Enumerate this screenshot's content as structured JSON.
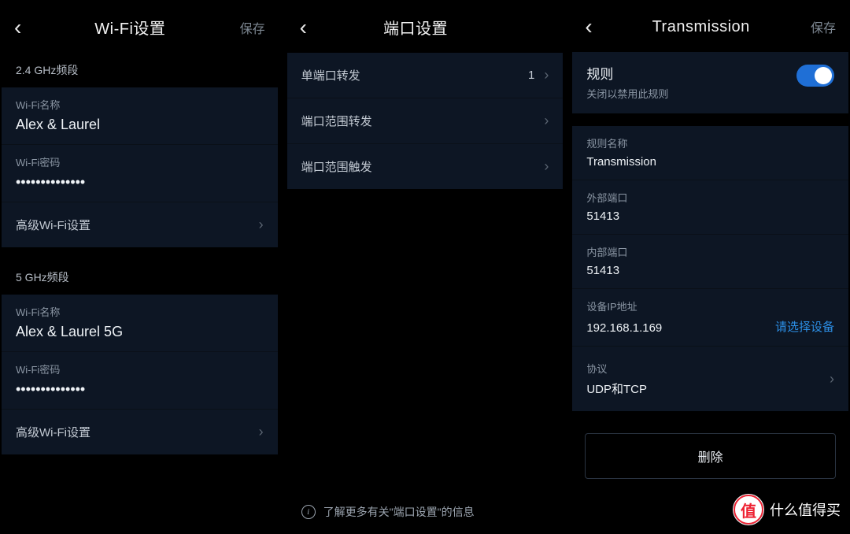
{
  "watermark": {
    "badge": "值",
    "text": "什么值得买"
  },
  "panel1": {
    "title": "Wi-Fi设置",
    "save": "保存",
    "band24_header": "2.4 GHz频段",
    "band5_header": "5 GHz频段",
    "name_label": "Wi-Fi名称",
    "pwd_label": "Wi-Fi密码",
    "adv_label": "高级Wi-Fi设置",
    "ssid24": "Alex & Laurel",
    "pwd24": "••••••••••••••",
    "ssid5": "Alex & Laurel 5G",
    "pwd5": "••••••••••••••"
  },
  "panel2": {
    "title": "端口设置",
    "items": {
      "single": "单端口转发",
      "single_count": "1",
      "range_fwd": "端口范围转发",
      "range_trig": "端口范围触发"
    },
    "footer": "了解更多有关\"端口设置\"的信息"
  },
  "panel3": {
    "title": "Transmission",
    "save": "保存",
    "rule_title": "规则",
    "rule_sub": "关闭以禁用此规则",
    "fields": {
      "name_label": "规则名称",
      "name_value": "Transmission",
      "ext_label": "外部端口",
      "ext_value": "51413",
      "int_label": "内部端口",
      "int_value": "51413",
      "ip_label": "设备IP地址",
      "ip_value": "192.168.1.169",
      "ip_action": "请选择设备",
      "proto_label": "协议",
      "proto_value": "UDP和TCP"
    },
    "delete": "删除"
  }
}
